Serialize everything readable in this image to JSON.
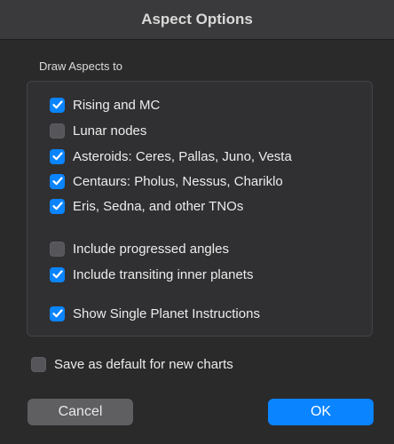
{
  "window": {
    "title": "Aspect Options"
  },
  "section": {
    "label": "Draw Aspects to"
  },
  "options": [
    {
      "label": "Rising and MC",
      "checked": true
    },
    {
      "label": "Lunar nodes",
      "checked": false
    },
    {
      "label": "Asteroids: Ceres, Pallas, Juno, Vesta",
      "checked": true
    },
    {
      "label": "Centaurs: Pholus, Nessus, Chariklo",
      "checked": true
    },
    {
      "label": "Eris, Sedna, and other TNOs",
      "checked": true
    },
    {
      "label": "Include progressed angles",
      "checked": false
    },
    {
      "label": "Include transiting inner planets",
      "checked": true
    },
    {
      "label": "Show Single Planet Instructions",
      "checked": true
    }
  ],
  "save_default": {
    "label": "Save as default for new charts",
    "checked": false
  },
  "buttons": {
    "cancel": "Cancel",
    "ok": "OK"
  },
  "colors": {
    "accent": "#0a84ff",
    "background": "#2a2a2b",
    "titlebar": "#3a3a3c"
  }
}
